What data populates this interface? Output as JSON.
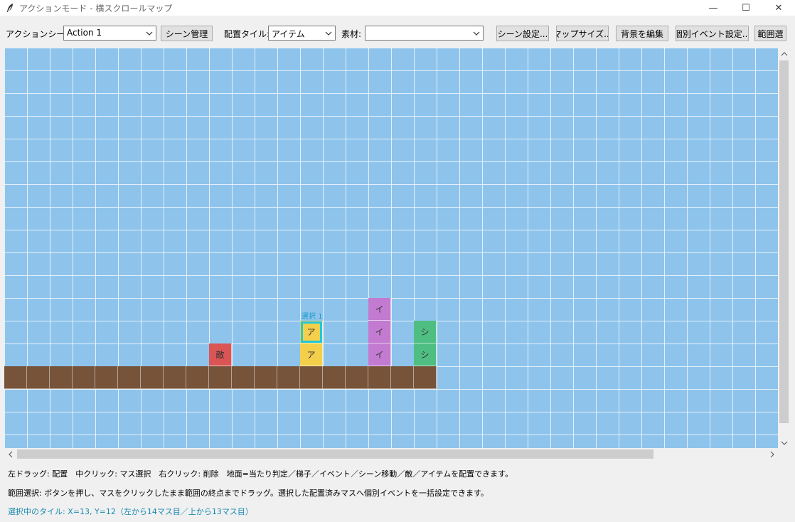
{
  "window": {
    "title": "アクションモード - 横スクロールマップ",
    "minimize": "—",
    "maximize": "☐",
    "close": "✕"
  },
  "toolbar": {
    "scene_label": "アクションシーン:",
    "scene_value": "Action 1",
    "scene_manage": "シーン管理",
    "tile_label": "配置タイル:",
    "tile_value": "アイテム",
    "material_label": "素材:",
    "material_value": "",
    "scene_settings": "シーン設定...",
    "map_size": "マップサイズ...",
    "edit_background": "背景を編集",
    "individual_event": "個別イベント設定...",
    "range_select": "範囲選"
  },
  "map": {
    "selection_label": "選択 1",
    "tiles": {
      "item": "ア",
      "ladder": "イ",
      "scene": "シ",
      "enemy": "敵"
    }
  },
  "help": {
    "line1": "左ドラッグ: 配置　中クリック: マス選択　右クリック: 削除　地面=当たり判定／梯子／イベント／シーン移動／敵／アイテムを配置できます。",
    "line2": "範囲選択: ボタンを押し、マスをクリックしたまま範囲の終点までドラッグ。選択した配置済みマスへ個別イベントを一括設定できます。",
    "status": "選択中のタイル: X=13, Y=12（左から14マス目／上から13マス目）"
  },
  "colors": {
    "sky": "#8ec4ec",
    "ground": "#77533a",
    "item": "#f4cf4c",
    "ladder": "#c27bd1",
    "scene": "#4fbe82",
    "enemy": "#dc5555",
    "selection": "#1fc8dc"
  },
  "icons": {
    "app": "feather-icon",
    "combo_arrow": "chevron-down-icon"
  }
}
